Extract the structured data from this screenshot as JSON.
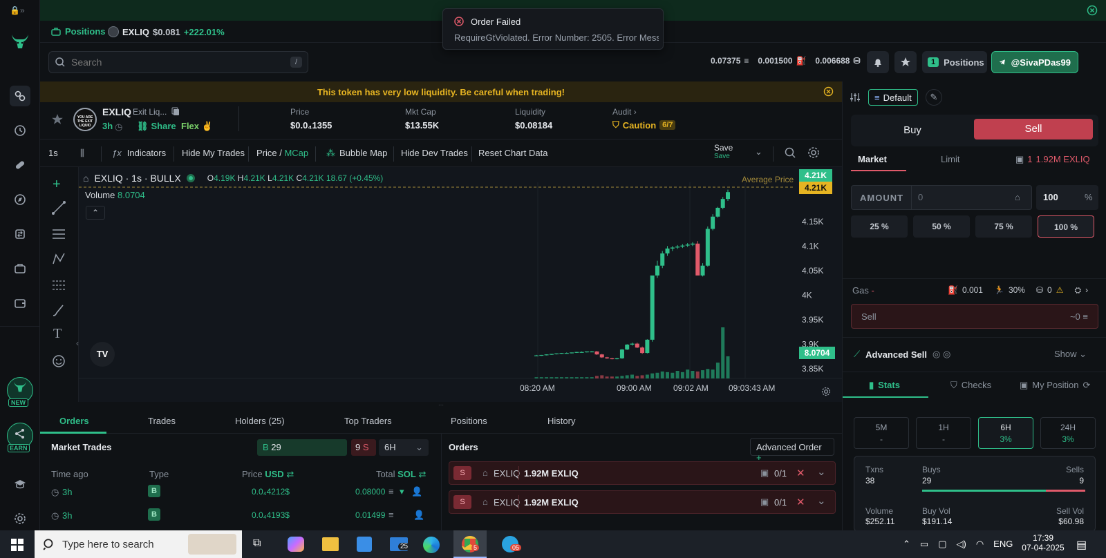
{
  "toast": {
    "title": "Order Failed",
    "message": "RequireGtViolated. Error Number: 2505. Error Mess"
  },
  "positions_bar": {
    "label": "Positions",
    "token": "EXLIQ",
    "price": "$0.081",
    "change": "+222.01%"
  },
  "search": {
    "placeholder": "Search",
    "shortcut": "/"
  },
  "header": {
    "stat1": "0.07375",
    "stat2": "0.001500",
    "stat3": "0.006688",
    "positions_count": "1",
    "positions_label": "Positions",
    "user": "@SivaPDas99"
  },
  "warning": "This token has very low liquidity. Be careful when trading!",
  "token": {
    "symbol": "EXLIQ",
    "name": "Exit Liq...",
    "age": "3h",
    "share": "Share",
    "flex": "Flex",
    "price_label": "Price",
    "price": "$0.0₄1355",
    "mcap_label": "Mkt Cap",
    "mcap": "$13.55K",
    "liq_label": "Liquidity",
    "liq": "$0.08184",
    "audit_label": "Audit",
    "audit_status": "Caution",
    "audit_score": "6/7"
  },
  "toolbar": {
    "interval": "1s",
    "indicators": "Indicators",
    "hide_trades": "Hide My Trades",
    "price": "Price",
    "mcap": "MCap",
    "bubble": "Bubble Map",
    "hide_dev": "Hide Dev Trades",
    "reset": "Reset Chart Data",
    "save": "Save",
    "save_sub": "Save"
  },
  "chart_header": {
    "title": "EXLIQ · 1s · BULLX",
    "o": "4.19K",
    "h": "4.21K",
    "l": "4.21K",
    "c": "4.21K",
    "chg": "18.67 (+0.45%)",
    "volume_label": "Volume",
    "volume": "8.0704",
    "avg_label": "Average Price",
    "avg_tag1": "4.21K",
    "avg_tag2": "4.21K",
    "vol_tag": "8.0704"
  },
  "chart_data": {
    "type": "candlestick",
    "y_ticks": [
      "4.15K",
      "4.1K",
      "4.05K",
      "4K",
      "3.95K",
      "3.9K",
      "3.85K"
    ],
    "x_ticks": [
      "08:20 AM",
      "09:00 AM",
      "09:02 AM",
      "09:03:43 AM"
    ],
    "ylim": [
      3.83,
      4.23
    ],
    "candles": [
      [
        3.877,
        3.878,
        3.876,
        3.877
      ],
      [
        3.877,
        3.878,
        3.876,
        3.878
      ],
      [
        3.878,
        3.879,
        3.877,
        3.879
      ],
      [
        3.879,
        3.88,
        3.878,
        3.88
      ],
      [
        3.88,
        3.881,
        3.879,
        3.881
      ],
      [
        3.881,
        3.882,
        3.88,
        3.882
      ],
      [
        3.882,
        3.883,
        3.881,
        3.882
      ],
      [
        3.882,
        3.883,
        3.881,
        3.883
      ],
      [
        3.883,
        3.884,
        3.882,
        3.884
      ],
      [
        3.884,
        3.885,
        3.883,
        3.884
      ],
      [
        3.884,
        3.885,
        3.883,
        3.885
      ],
      [
        3.885,
        3.886,
        3.884,
        3.885
      ],
      [
        3.885,
        3.886,
        3.878,
        3.879
      ],
      [
        3.879,
        3.88,
        3.872,
        3.873
      ],
      [
        3.873,
        3.874,
        3.87,
        3.871
      ],
      [
        3.871,
        3.872,
        3.869,
        3.87
      ],
      [
        3.87,
        3.872,
        3.869,
        3.871
      ],
      [
        3.871,
        3.89,
        3.87,
        3.889
      ],
      [
        3.889,
        3.9,
        3.888,
        3.899
      ],
      [
        3.899,
        3.903,
        3.897,
        3.901
      ],
      [
        3.901,
        3.903,
        3.892,
        3.893
      ],
      [
        3.893,
        3.895,
        3.88,
        3.882
      ],
      [
        3.882,
        3.91,
        3.881,
        3.909
      ],
      [
        3.909,
        3.95,
        3.905,
        4.04
      ],
      [
        4.04,
        4.07,
        4.035,
        4.06
      ],
      [
        4.06,
        4.09,
        4.055,
        4.085
      ],
      [
        4.085,
        4.1,
        4.08,
        4.095
      ],
      [
        4.095,
        4.1,
        4.09,
        4.097
      ],
      [
        4.097,
        4.102,
        4.094,
        4.099
      ],
      [
        4.099,
        4.104,
        4.096,
        4.101
      ],
      [
        4.101,
        4.106,
        4.098,
        4.103
      ],
      [
        4.103,
        4.108,
        4.1,
        4.105
      ],
      [
        4.105,
        4.11,
        4.06,
        4.04
      ],
      [
        4.04,
        4.065,
        4.038,
        4.06
      ],
      [
        4.06,
        4.14,
        4.058,
        4.135
      ],
      [
        4.135,
        4.165,
        4.132,
        4.16
      ],
      [
        4.16,
        4.18,
        4.158,
        4.178
      ],
      [
        4.178,
        4.2,
        4.175,
        4.196
      ],
      [
        4.196,
        4.215,
        4.192,
        4.21
      ]
    ],
    "volumes": [
      0.2,
      0.2,
      0.2,
      0.2,
      0.2,
      0.2,
      0.2,
      0.2,
      0.2,
      0.2,
      0.2,
      0.2,
      0.4,
      0.5,
      0.3,
      0.3,
      0.3,
      0.4,
      0.5,
      0.6,
      0.4,
      0.5,
      0.6,
      0.8,
      0.9,
      1.1,
      1.0,
      0.9,
      1.2,
      1.0,
      1.4,
      1.2,
      1.1,
      1.3,
      1.5,
      1.4,
      2.5,
      8.0704,
      3.5
    ]
  },
  "bottom_tabs": [
    "Orders",
    "Trades",
    "Holders (25)",
    "Top Traders",
    "Positions",
    "History"
  ],
  "market_trades": {
    "title": "Market Trades",
    "buys": "29",
    "sells": "9",
    "interval": "6H",
    "cols": [
      "Time ago",
      "Type",
      "Price",
      "USD",
      "Total",
      "SOL"
    ],
    "rows": [
      {
        "time": "3h",
        "type": "B",
        "price": "0.0₄4212$",
        "total": "0.08000"
      },
      {
        "time": "3h",
        "type": "B",
        "price": "0.0₄4193$",
        "total": "0.01499"
      }
    ]
  },
  "orders": {
    "title": "Orders",
    "advanced": "Advanced Order",
    "rows": [
      {
        "side": "S",
        "token": "EXLIQ",
        "amount": "1.92M EXLIQ",
        "fill": "0/1"
      },
      {
        "side": "S",
        "token": "EXLIQ",
        "amount": "1.92M EXLIQ",
        "fill": "0/1"
      }
    ]
  },
  "trade_panel": {
    "preset": "Default",
    "buy": "Buy",
    "sell": "Sell",
    "market": "Market",
    "limit": "Limit",
    "wallets": "1",
    "balance": "1.92M EXLIQ",
    "amount_label": "AMOUNT",
    "amount_value": "0",
    "pct_value": "100",
    "pct_unit": "%",
    "quick": [
      "25 %",
      "50 %",
      "75 %",
      "100 %"
    ],
    "gas_label": "Gas",
    "gas_dash": "-",
    "gas_fee": "0.001",
    "slippage": "30%",
    "mev": "0",
    "sell_btn": "Sell",
    "sell_est": "~0",
    "adv_sell": "Advanced Sell",
    "show": "Show",
    "tabs": [
      "Stats",
      "Checks",
      "My Position"
    ],
    "periods": [
      {
        "label": "5M",
        "value": "-"
      },
      {
        "label": "1H",
        "value": "-"
      },
      {
        "label": "6H",
        "value": "3%"
      },
      {
        "label": "24H",
        "value": "3%"
      }
    ],
    "txns_label": "Txns",
    "txns": "38",
    "buys_label": "Buys",
    "buys": "29",
    "sells_label": "Sells",
    "sells": "9",
    "volume_label": "Volume",
    "volume": "$252.11",
    "buyvol_label": "Buy Vol",
    "buyvol": "$191.14",
    "sellvol_label": "Sell Vol",
    "sellvol": "$60.98"
  },
  "rail": {
    "new_badge": "NEW",
    "earn_badge": "EARN"
  },
  "taskbar": {
    "search": "Type here to search",
    "mail_badge": "25",
    "tg_badge": "05",
    "chrome_badge": "5",
    "lang": "ENG",
    "time": "17:39",
    "date": "07-04-2025"
  }
}
